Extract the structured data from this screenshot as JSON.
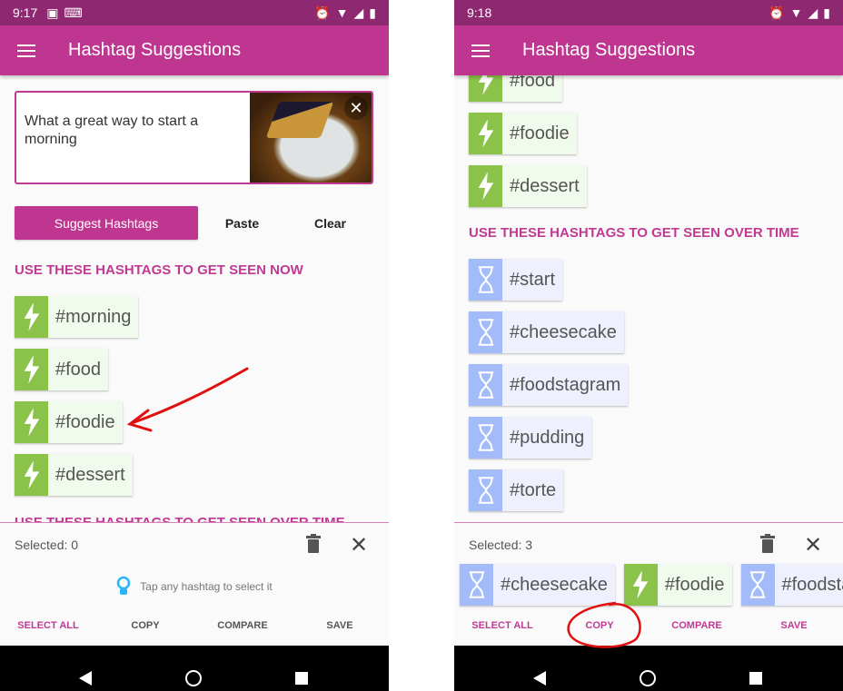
{
  "colors": {
    "primary": "#bf3690",
    "status_bar": "#8e2870",
    "now_green": "#8bc34a",
    "overtime_blue": "#a3bcf9",
    "annotation": "#e01010"
  },
  "left": {
    "status_time": "9:17",
    "title": "Hashtag Suggestions",
    "input_text": "What a great way to start a morning",
    "buttons": {
      "suggest": "Suggest Hashtags",
      "paste": "Paste",
      "clear": "Clear"
    },
    "heading_now": "USE THESE HASHTAGS TO GET SEEN NOW",
    "now_tags": [
      "#morning",
      "#food",
      "#foodie",
      "#dessert"
    ],
    "heading_overtime": "USE THESE HASHTAGS TO GET SEEN OVER TIME",
    "selected": "Selected: 0",
    "tip": "Tap any hashtag to select it",
    "actions": [
      "SELECT ALL",
      "COPY",
      "COMPARE",
      "SAVE"
    ]
  },
  "right": {
    "status_time": "9:18",
    "title": "Hashtag Suggestions",
    "now_tags": [
      "#food",
      "#foodie",
      "#dessert"
    ],
    "heading_overtime": "USE THESE HASHTAGS TO GET SEEN OVER TIME",
    "overtime_tags": [
      "#start",
      "#cheesecake",
      "#foodstagram",
      "#pudding",
      "#torte"
    ],
    "selected": "Selected: 3",
    "selected_tags": [
      {
        "tag": "#cheesecake",
        "type": "overtime"
      },
      {
        "tag": "#foodie",
        "type": "now"
      },
      {
        "tag": "#foodstagram",
        "type": "overtime"
      }
    ],
    "actions": [
      "SELECT ALL",
      "COPY",
      "COMPARE",
      "SAVE"
    ]
  }
}
